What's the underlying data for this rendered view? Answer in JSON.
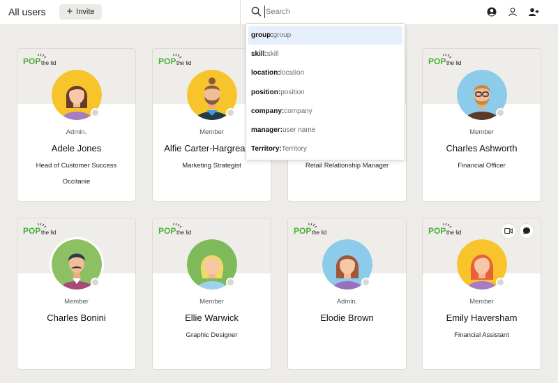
{
  "header": {
    "title": "All users",
    "invite_label": "Invite",
    "search_placeholder": "Search"
  },
  "logo_text": "POP the lid",
  "search_suggestions": [
    {
      "key": "group:",
      "hint": "group"
    },
    {
      "key": "skill:",
      "hint": "skill"
    },
    {
      "key": "location:",
      "hint": "location"
    },
    {
      "key": "position:",
      "hint": "position"
    },
    {
      "key": "company:",
      "hint": "company"
    },
    {
      "key": "manager:",
      "hint": "user name"
    },
    {
      "key": "Territory:",
      "hint": "Territory"
    }
  ],
  "users": [
    {
      "role": "Admin.",
      "name": "Adele Jones",
      "title": "Head of Customer Success",
      "location": "Occitanie"
    },
    {
      "role": "Member",
      "name": "Alfie Carter-Hargreaves",
      "title": "Marketing Strategist",
      "location": ""
    },
    {
      "role": "",
      "name": "",
      "title": "Retail Relationship Manager",
      "location": ""
    },
    {
      "role": "Member",
      "name": "Charles Ashworth",
      "title": "Financial Officer",
      "location": ""
    },
    {
      "role": "Member",
      "name": "Charles Bonini",
      "title": "",
      "location": ""
    },
    {
      "role": "Member",
      "name": "Ellie Warwick",
      "title": "Graphic Designer",
      "location": ""
    },
    {
      "role": "Admin.",
      "name": "Elodie Brown",
      "title": "",
      "location": ""
    },
    {
      "role": "Member",
      "name": "Emily Haversham",
      "title": "Financial Assistant",
      "location": ""
    }
  ],
  "colors": {
    "background": "#eeece9",
    "card_band": "#efede9",
    "logo_green": "#4caf3a",
    "suggestion_highlight": "#e6f0fa"
  }
}
